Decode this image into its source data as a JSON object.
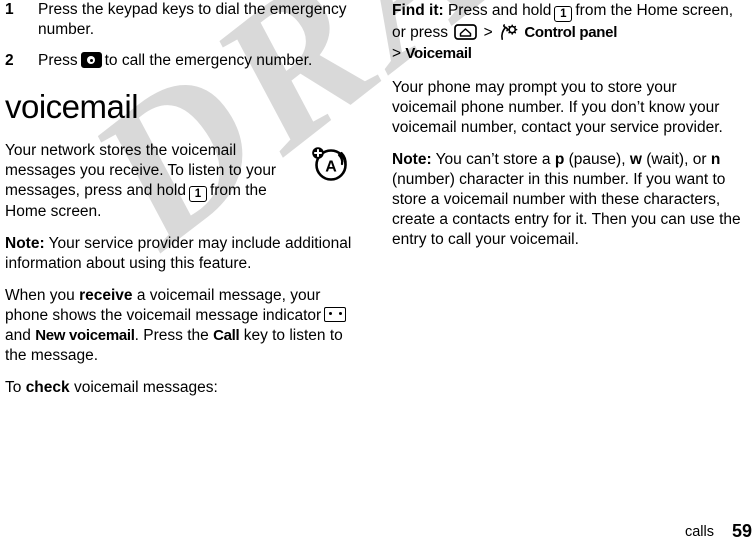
{
  "document": {
    "watermark": "DRAFT",
    "footer": {
      "chapter": "calls",
      "page_number": "59"
    }
  },
  "left_column": {
    "steps": [
      {
        "number": "1",
        "text": "Press the keypad keys to dial the emergency number."
      },
      {
        "number": "2",
        "text_before_icon": "Press",
        "icon": "send-key-icon",
        "text_after_icon": "to call the emergency number."
      }
    ],
    "section_title": "voicemail",
    "margin_icon": "alert-network-icon",
    "paragraphs": [
      {
        "id": "intro",
        "part1": "Your network stores the voicemail messages you receive. To listen to your messages, press and hold",
        "icon": "key-1-icon",
        "part2": "from the Home screen."
      },
      {
        "id": "note-provider",
        "lead": "Note:",
        "part1": "Your service provider may include additional information about using this feature."
      },
      {
        "id": "receive",
        "part1": "When you",
        "bold1": "receive",
        "part2": "a voicemail message, your phone shows the voicemail message indicator",
        "icon": "voicemail-indicator-icon",
        "part3": "and",
        "ui1": "New voicemail",
        "part4": ". Press the",
        "ui2": "Call",
        "part5": "key to listen to the message."
      },
      {
        "id": "to-check",
        "part1": "To",
        "bold1": "check",
        "part2": "voicemail messages:"
      }
    ]
  },
  "right_column": {
    "find_it": {
      "lead": "Find it:",
      "part1": "Press and hold",
      "icon1": "key-1-icon",
      "part2": "from the Home screen, or press",
      "icon2": "home-key-icon",
      "separator1": ">",
      "icon3": "control-panel-gear-icon",
      "menu1": "Control panel",
      "separator2": ">",
      "menu2": "Voicemail"
    },
    "paragraphs": [
      {
        "id": "prompt",
        "part1": "Your phone may prompt you to store your voicemail phone number. If you don’t know your voicemail number, contact your service provider."
      },
      {
        "id": "note-chars",
        "lead": "Note:",
        "part1": "You can’t store a",
        "char1": "p",
        "part2": "(pause),",
        "char2": "w",
        "part3": "(wait), or",
        "char3": "n",
        "part4": "(number) character in this number. If you want to store a voicemail number with these characters, create a contacts entry for it. Then you can use the entry to call your voicemail."
      }
    ]
  },
  "colors": {
    "text": "#000000",
    "watermark": "#d9d9d9",
    "background": "#ffffff"
  }
}
